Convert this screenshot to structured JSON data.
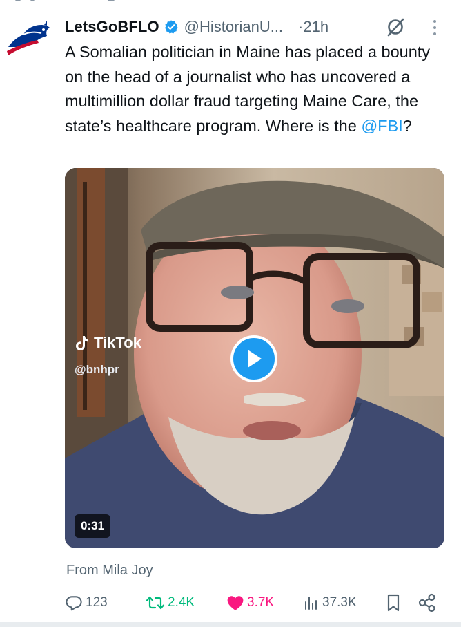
{
  "tweet": {
    "author": {
      "display_name": "LetsGoBFLO",
      "handle": "@HistorianU...",
      "verified": true,
      "avatar_icon": "buffalo-logo-icon"
    },
    "time": "21h",
    "time_prefix": "·",
    "text_before": "A Somalian politician in Maine has placed a bounty on the head of a journalist who has uncovered a multimillion dollar fraud targeting Maine Care, the state’s healthcare program. Where is the ",
    "mention": "@FBI",
    "text_after": "?",
    "media": {
      "type": "video",
      "watermark_brand": "TikTok",
      "watermark_handle": "@bnhpr",
      "duration": "0:31",
      "play_icon": "play-icon"
    },
    "attribution": "From Mila Joy",
    "stats": {
      "replies": "123",
      "reposts": "2.4K",
      "likes": "3.7K",
      "views": "37.3K"
    }
  },
  "colors": {
    "link": "#1d9bf0",
    "secondary_text": "#536471",
    "repost_active": "#00ba7c",
    "like_active": "#f91880",
    "verified_badge": "#1d9bf0"
  }
}
